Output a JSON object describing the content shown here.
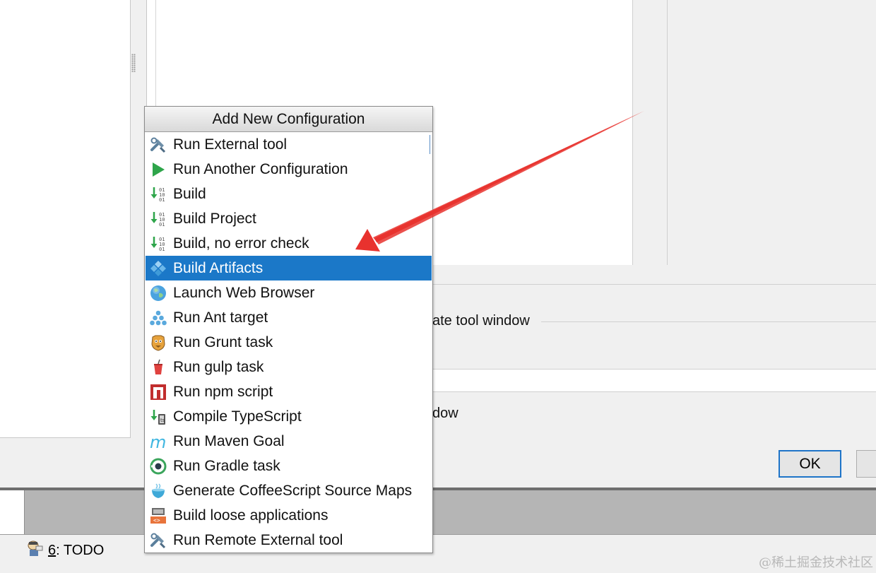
{
  "background": {
    "activate_label": "ate tool window",
    "window_label": "dow",
    "ok_label": "OK"
  },
  "status_bar": {
    "todo_number": "6",
    "todo_label": ": TODO"
  },
  "watermark": "@稀土掘金技术社区",
  "popup": {
    "title": "Add New Configuration",
    "selected_item": "Build Artifacts",
    "items": [
      {
        "label": "Run External tool",
        "icon": "external-tool-icon"
      },
      {
        "label": "Run Another Configuration",
        "icon": "run-play-icon"
      },
      {
        "label": "Build",
        "icon": "build-icon"
      },
      {
        "label": "Build Project",
        "icon": "build-icon"
      },
      {
        "label": "Build, no error check",
        "icon": "build-icon"
      },
      {
        "label": "Build Artifacts",
        "icon": "artifacts-icon"
      },
      {
        "label": "Launch Web Browser",
        "icon": "globe-icon"
      },
      {
        "label": "Run Ant target",
        "icon": "ant-icon"
      },
      {
        "label": "Run Grunt task",
        "icon": "grunt-icon"
      },
      {
        "label": "Run gulp task",
        "icon": "gulp-icon"
      },
      {
        "label": "Run npm script",
        "icon": "npm-icon"
      },
      {
        "label": "Compile TypeScript",
        "icon": "typescript-compile-icon"
      },
      {
        "label": "Run Maven Goal",
        "icon": "maven-icon"
      },
      {
        "label": "Run Gradle task",
        "icon": "gradle-icon"
      },
      {
        "label": "Generate CoffeeScript Source Maps",
        "icon": "coffeescript-icon"
      },
      {
        "label": "Build loose applications",
        "icon": "loose-app-icon"
      },
      {
        "label": "Run Remote External tool",
        "icon": "remote-tool-icon"
      }
    ]
  },
  "colors": {
    "selection": "#1b78c8",
    "annotation_arrow": "#e8322e",
    "ok_focus_border": "#1e74c8"
  }
}
